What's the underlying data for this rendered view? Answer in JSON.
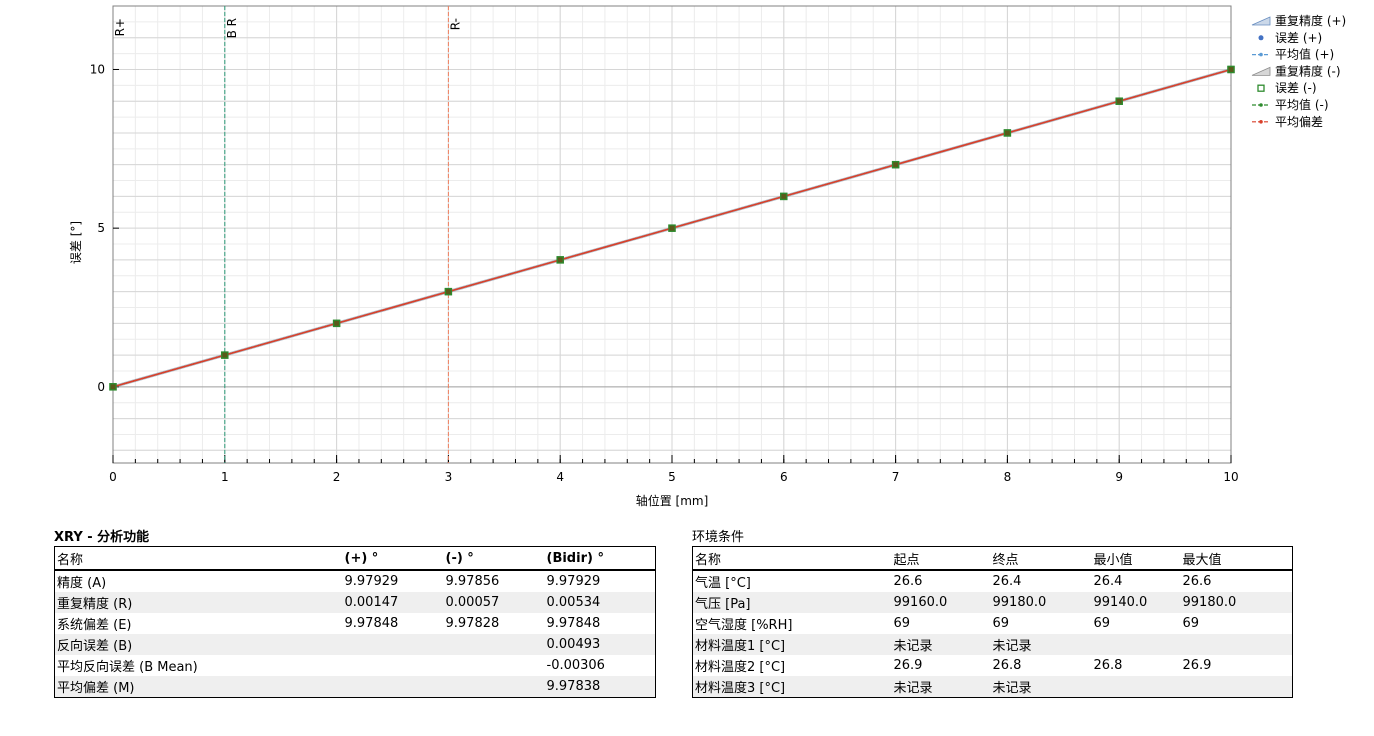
{
  "chart_data": {
    "type": "line",
    "title": "",
    "xlabel": "轴位置 [mm]",
    "ylabel": "误差 [°]",
    "xlim": [
      0,
      10
    ],
    "ylim": [
      -2.4,
      12
    ],
    "x_ticks": [
      0,
      1,
      2,
      3,
      4,
      5,
      6,
      7,
      8,
      9,
      10
    ],
    "y_ticks": [
      0,
      5,
      10
    ],
    "grid": true,
    "legend_position": "right",
    "vertical_markers": [
      {
        "x": 0,
        "label": "R+",
        "color": "#808080"
      },
      {
        "x": 1,
        "label": "B R",
        "color": "#2e9c7a"
      },
      {
        "x": 3,
        "label": "R-",
        "color": "#f08060"
      }
    ],
    "series": [
      {
        "name": "重复精度 (+)",
        "legend_symbol": "band",
        "color": "#6a8fc0",
        "x": [
          0,
          1,
          2,
          3,
          4,
          5,
          6,
          7,
          8,
          9,
          10
        ],
        "y": [
          0,
          1,
          2,
          3,
          4,
          5,
          6,
          7,
          8,
          9,
          10
        ]
      },
      {
        "name": "误差 (+)",
        "legend_symbol": "dot",
        "color": "#4472c4",
        "x": [
          0,
          1,
          2,
          3,
          4,
          5,
          6,
          7,
          8,
          9,
          10
        ],
        "y": [
          0,
          1,
          2,
          3,
          4,
          5,
          6,
          7,
          8,
          9,
          10
        ]
      },
      {
        "name": "平均值 (+)",
        "legend_symbol": "dash-dot",
        "color": "#5b9bd5",
        "x": [
          0,
          1,
          2,
          3,
          4,
          5,
          6,
          7,
          8,
          9,
          10
        ],
        "y": [
          0,
          1,
          2,
          3,
          4,
          5,
          6,
          7,
          8,
          9,
          10
        ]
      },
      {
        "name": "重复精度 (-)",
        "legend_symbol": "band",
        "color": "#8c8c8c",
        "x": [
          0,
          1,
          2,
          3,
          4,
          5,
          6,
          7,
          8,
          9,
          10
        ],
        "y": [
          0,
          1,
          2,
          3,
          4,
          5,
          6,
          7,
          8,
          9,
          10
        ]
      },
      {
        "name": "误差 (-)",
        "legend_symbol": "square",
        "color": "#2e8b2e",
        "x": [
          0,
          1,
          2,
          3,
          4,
          5,
          6,
          7,
          8,
          9,
          10
        ],
        "y": [
          0,
          1,
          2,
          3,
          4,
          5,
          6,
          7,
          8,
          9,
          10
        ]
      },
      {
        "name": "平均值 (-)",
        "legend_symbol": "dash-dot",
        "color": "#2e8b2e",
        "x": [
          0,
          1,
          2,
          3,
          4,
          5,
          6,
          7,
          8,
          9,
          10
        ],
        "y": [
          0,
          1,
          2,
          3,
          4,
          5,
          6,
          7,
          8,
          9,
          10
        ]
      },
      {
        "name": "平均偏差",
        "legend_symbol": "dash-dot",
        "color": "#d9402b",
        "x": [
          0,
          1,
          2,
          3,
          4,
          5,
          6,
          7,
          8,
          9,
          10
        ],
        "y": [
          0,
          1,
          2,
          3,
          4,
          5,
          6,
          7,
          8,
          9,
          10
        ]
      }
    ]
  },
  "analysis": {
    "title": "XRY - 分析功能",
    "headers": [
      "名称",
      "(+) °",
      "(-) °",
      "(Bidir) °"
    ],
    "rows": [
      [
        "精度 (A)",
        "9.97929",
        "9.97856",
        "9.97929"
      ],
      [
        "重复精度 (R)",
        "0.00147",
        "0.00057",
        "0.00534"
      ],
      [
        "系统偏差 (E)",
        "9.97848",
        "9.97828",
        "9.97848"
      ],
      [
        "反向误差 (B)",
        "",
        "",
        "0.00493"
      ],
      [
        "平均反向误差 (B Mean)",
        "",
        "",
        "-0.00306"
      ],
      [
        "平均偏差 (M)",
        "",
        "",
        "9.97838"
      ]
    ]
  },
  "environment": {
    "title": "环境条件",
    "headers": [
      "名称",
      "起点",
      "终点",
      "最小值",
      "最大值"
    ],
    "rows": [
      [
        "气温 [°C]",
        "26.6",
        "26.4",
        "26.4",
        "26.6"
      ],
      [
        "气压 [Pa]",
        "99160.0",
        "99180.0",
        "99140.0",
        "99180.0"
      ],
      [
        "空气湿度 [%RH]",
        "69",
        "69",
        "69",
        "69"
      ],
      [
        "材料温度1 [°C]",
        "未记录",
        "未记录",
        "",
        ""
      ],
      [
        "材料温度2 [°C]",
        "26.9",
        "26.8",
        "26.8",
        "26.9"
      ],
      [
        "材料温度3 [°C]",
        "未记录",
        "未记录",
        "",
        ""
      ]
    ]
  }
}
